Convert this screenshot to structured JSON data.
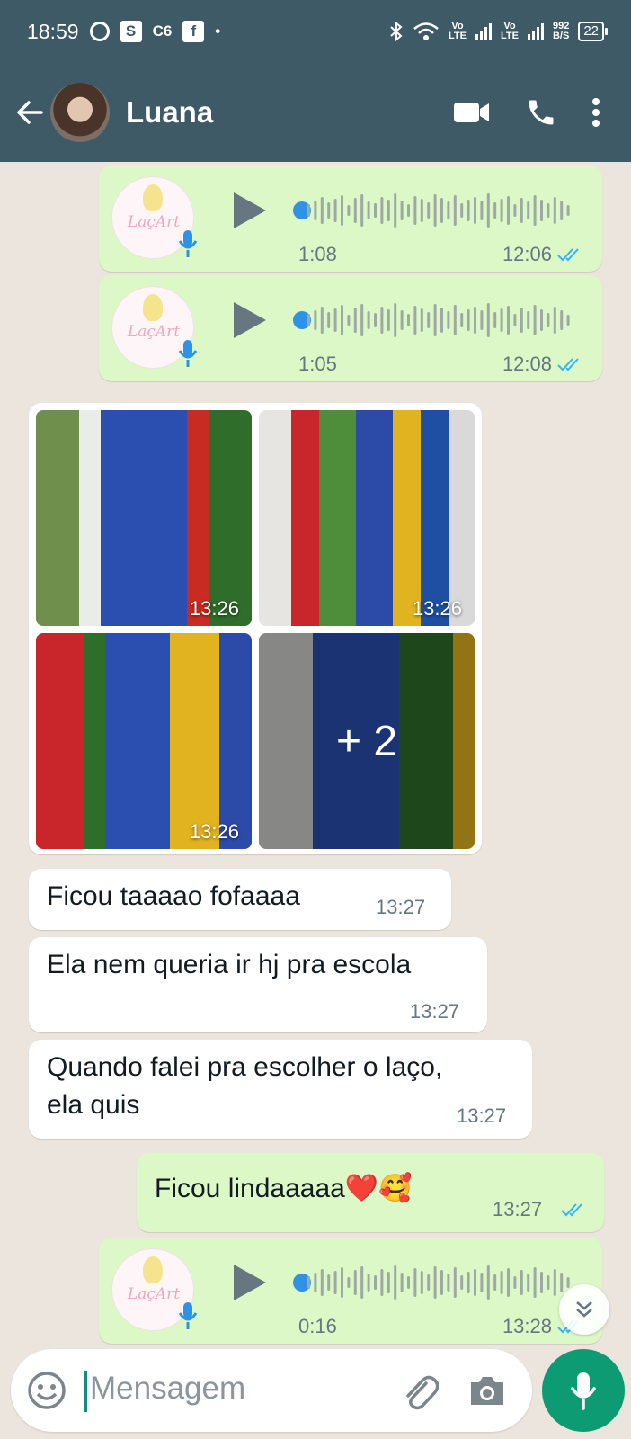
{
  "status_bar": {
    "time": "18:59",
    "icons": [
      "sync-icon",
      "s-app-icon",
      "c6-icon",
      "facebook-icon",
      "dot-icon"
    ],
    "c6_label": "C6",
    "s_label": "S",
    "fb_label": "f",
    "volte1": "Vo\nLTE",
    "volte2": "Vo\nLTE",
    "net_speed": "992\nB/S",
    "battery": "22"
  },
  "header": {
    "contact_name": "Luana"
  },
  "messages": [
    {
      "type": "voice",
      "direction": "out",
      "duration": "1:08",
      "time": "12:06",
      "logo": "LaçArt"
    },
    {
      "type": "voice",
      "direction": "out",
      "duration": "1:05",
      "time": "12:08",
      "logo": "LaçArt"
    },
    {
      "type": "album",
      "direction": "in",
      "photos": [
        {
          "time": "13:26"
        },
        {
          "time": "13:26"
        },
        {
          "time": "13:26"
        },
        {
          "more": "+ 2"
        }
      ]
    },
    {
      "type": "text",
      "direction": "in",
      "text": "Ficou taaaao fofaaaa",
      "time": "13:27"
    },
    {
      "type": "text",
      "direction": "in",
      "text": "Ela nem queria ir hj pra escola",
      "time": "13:27"
    },
    {
      "type": "text",
      "direction": "in",
      "text_line1": "Quando falei pra escolher o laço,",
      "text_line2": "ela quis",
      "time": "13:27"
    },
    {
      "type": "text",
      "direction": "out",
      "text": "Ficou lindaaaaa❤️🥰",
      "time": "13:27"
    },
    {
      "type": "voice",
      "direction": "out",
      "duration": "0:16",
      "time": "13:28",
      "logo": "LaçArt"
    }
  ],
  "input": {
    "placeholder": "Mensagem"
  },
  "colors": {
    "header": "#3e5a66",
    "chat_bg": "#ece5dd",
    "outgoing": "#dcf8c6",
    "incoming": "#ffffff",
    "tick_read": "#34b7f1",
    "mic_button": "#0d9b74"
  }
}
